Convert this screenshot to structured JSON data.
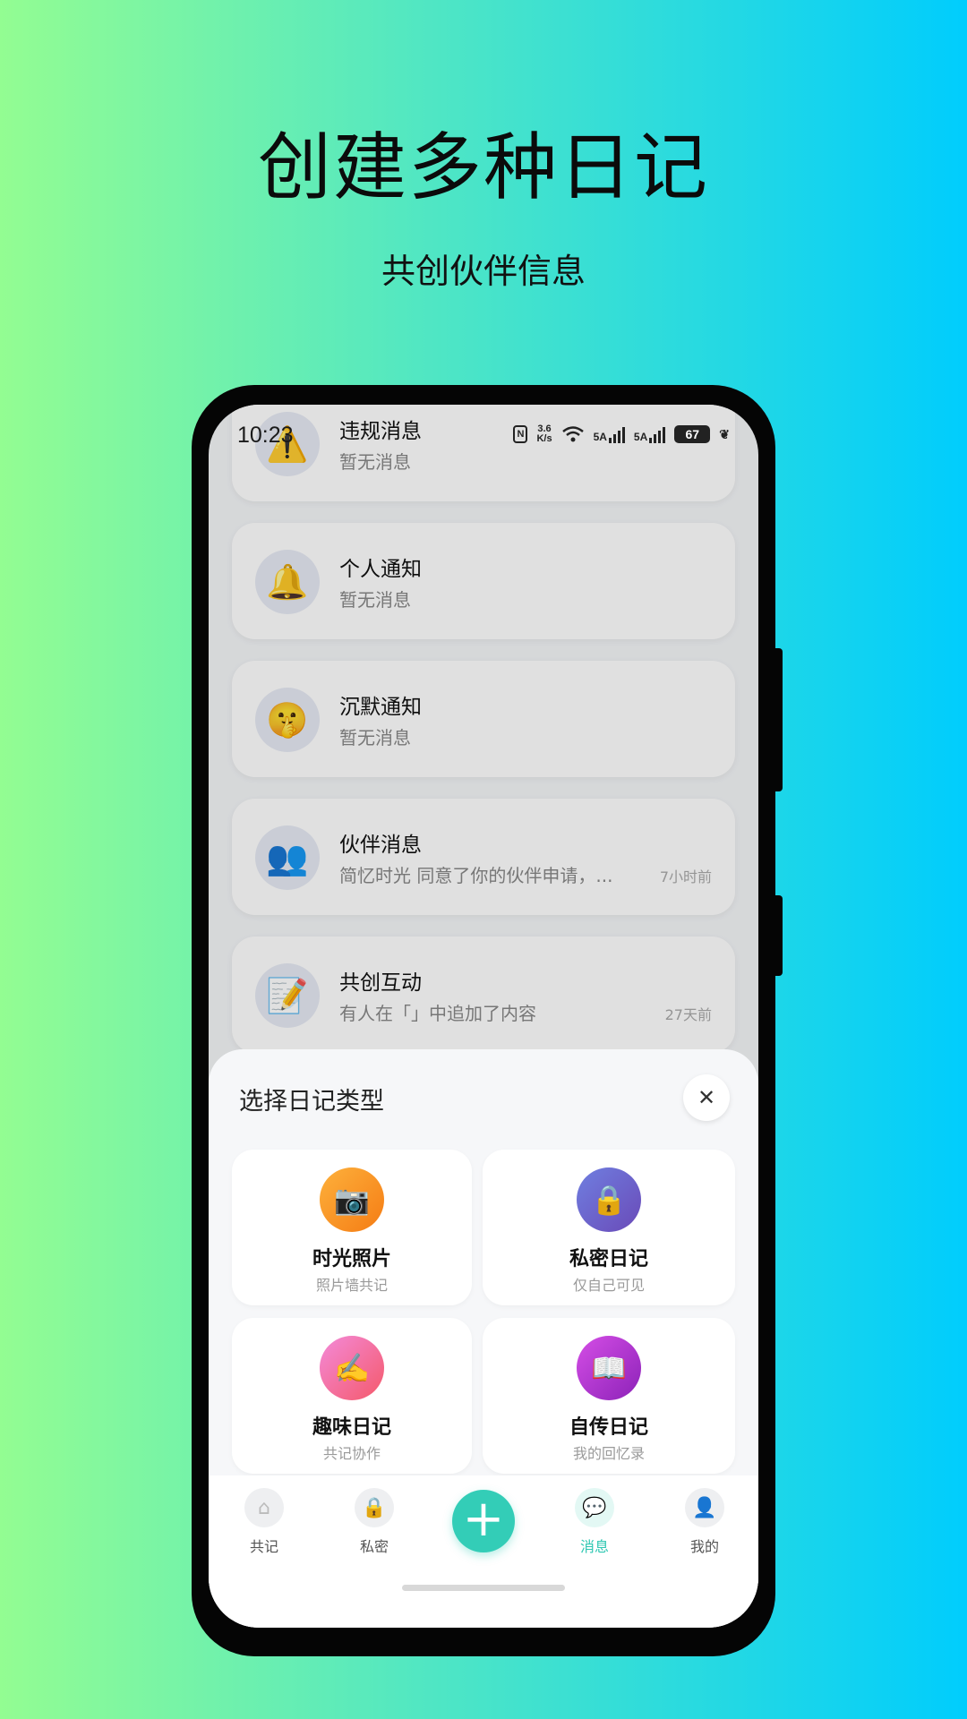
{
  "promo": {
    "title": "创建多种日记",
    "subtitle": "共创伙伴信息"
  },
  "status_bar": {
    "time": "10:23",
    "speed": "3.6\nK/s",
    "network1": "5A",
    "network2": "5A",
    "battery": "67"
  },
  "messages": [
    {
      "title": "违规消息",
      "desc": "暂无消息",
      "time": "",
      "icon": "⚠️"
    },
    {
      "title": "个人通知",
      "desc": "暂无消息",
      "time": "",
      "icon": "🔔"
    },
    {
      "title": "沉默通知",
      "desc": "暂无消息",
      "time": "",
      "icon": "🤫"
    },
    {
      "title": "伙伴消息",
      "desc": "简忆时光 同意了你的伙伴申请，...",
      "time": "7小时前",
      "icon": "👥"
    },
    {
      "title": "共创互动",
      "desc": "有人在「」中追加了内容",
      "time": "27天前",
      "icon": "📝"
    }
  ],
  "sheet": {
    "title": "选择日记类型",
    "close": "✕",
    "options": [
      {
        "name": "时光照片",
        "desc": "照片墙共记",
        "icon": "📷",
        "color": "#f8962a"
      },
      {
        "name": "私密日记",
        "desc": "仅自己可见",
        "icon": "🔒",
        "color": "#6a62c9"
      },
      {
        "name": "趣味日记",
        "desc": "共记协作",
        "icon": "✍️",
        "color": "#f56e95"
      },
      {
        "name": "自传日记",
        "desc": "我的回忆录",
        "icon": "📖",
        "color": "#b93ad6"
      }
    ]
  },
  "tabbar": {
    "tabs": [
      {
        "label": "共记",
        "icon": "⌂"
      },
      {
        "label": "私密",
        "icon": "🔒"
      },
      {
        "label": "消息",
        "icon": "💬"
      },
      {
        "label": "我的",
        "icon": "👤"
      }
    ],
    "add": "+"
  },
  "colors": {
    "accent": "#33cdb7"
  }
}
